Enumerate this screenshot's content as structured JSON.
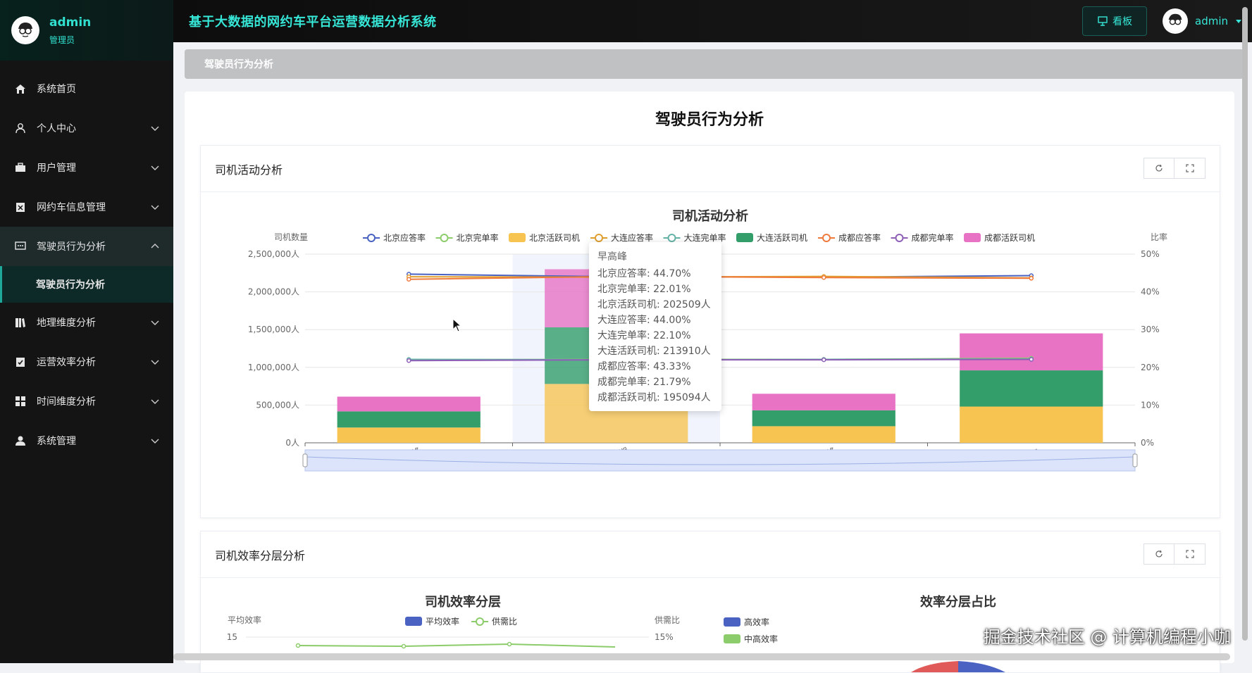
{
  "user": {
    "name": "admin",
    "role": "管理员"
  },
  "menu": [
    {
      "label": "系统首页",
      "icon": "home-icon",
      "chevron": false
    },
    {
      "label": "个人中心",
      "icon": "user-icon",
      "chevron": true
    },
    {
      "label": "用户管理",
      "icon": "briefcase-icon",
      "chevron": true
    },
    {
      "label": "网约车信息管理",
      "icon": "clipboard-icon",
      "chevron": true
    },
    {
      "label": "驾驶员行为分析",
      "icon": "chat-icon",
      "chevron": true,
      "active": true
    },
    {
      "label": "地理维度分析",
      "icon": "books-icon",
      "chevron": true
    },
    {
      "label": "运营效率分析",
      "icon": "clipboard-check-icon",
      "chevron": true
    },
    {
      "label": "时间维度分析",
      "icon": "grid-icon",
      "chevron": true
    },
    {
      "label": "系统管理",
      "icon": "person-icon",
      "chevron": true
    }
  ],
  "submenu_active": "驾驶员行为分析",
  "header": {
    "title": "基于大数据的网约车平台运营数据分析系统",
    "board_label": "看板",
    "user": "admin"
  },
  "breadcrumb": "驾驶员行为分析",
  "page_title": "驾驶员行为分析",
  "card1": {
    "title": "司机活动分析"
  },
  "card2": {
    "title": "司机效率分层分析"
  },
  "tooltip": {
    "title": "早高峰",
    "rows": [
      "北京应答率: 44.70%",
      "北京完单率: 22.01%",
      "北京活跃司机: 202509人",
      "大连应答率: 44.00%",
      "大连完单率: 22.10%",
      "大连活跃司机: 213910人",
      "成都应答率: 43.33%",
      "成都完单率: 21.79%",
      "成都活跃司机: 195094人"
    ]
  },
  "watermark": "掘金技术社区 @ 计算机编程小咖",
  "chart_data": [
    {
      "type": "bar",
      "title": "司机活动分析",
      "ylabel": "司机数量",
      "y2label": "比率",
      "categories": [
        "早高峰",
        "平峰期",
        "晚高峰",
        "夜间"
      ],
      "yticks": [
        "0人",
        "500,000人",
        "1,000,000人",
        "1,500,000人",
        "2,000,000人",
        "2,500,000人"
      ],
      "y2ticks": [
        "0%",
        "10%",
        "20%",
        "30%",
        "40%",
        "50%"
      ],
      "ylim": [
        0,
        2500000
      ],
      "y2lim": [
        0,
        50
      ],
      "legend": [
        "北京应答率",
        "北京完单率",
        "北京活跃司机",
        "大连应答率",
        "大连完单率",
        "大连活跃司机",
        "成都应答率",
        "成都完单率",
        "成都活跃司机"
      ],
      "bar_series": [
        {
          "name": "北京活跃司机",
          "color": "#f7c452",
          "values": [
            202509,
            780000,
            220000,
            480000
          ]
        },
        {
          "name": "大连活跃司机",
          "color": "#339e6a",
          "values": [
            213910,
            750000,
            210000,
            480000
          ]
        },
        {
          "name": "成都活跃司机",
          "color": "#e872c4",
          "values": [
            195094,
            770000,
            220000,
            490000
          ]
        }
      ],
      "line_series": [
        {
          "name": "北京应答率",
          "color": "#4a62c2",
          "values": [
            44.7,
            44.0,
            43.9,
            44.3
          ]
        },
        {
          "name": "北京完单率",
          "color": "#8ccc6a",
          "values": [
            22.01,
            22.1,
            22.1,
            22.4
          ]
        },
        {
          "name": "大连应答率",
          "color": "#e0a030",
          "values": [
            44.0,
            43.9,
            44.1,
            43.7
          ]
        },
        {
          "name": "大连完单率",
          "color": "#66b3a8",
          "values": [
            22.1,
            22.0,
            22.1,
            22.2
          ]
        },
        {
          "name": "成都应答率",
          "color": "#ef7a3c",
          "values": [
            43.33,
            44.1,
            43.8,
            43.6
          ]
        },
        {
          "name": "成都完单率",
          "color": "#8e5fb6",
          "values": [
            21.79,
            22.0,
            22.0,
            22.1
          ]
        }
      ],
      "highlight_category": "平峰期"
    },
    {
      "type": "line",
      "title": "司机效率分层",
      "ylabel": "平均效率",
      "y2label": "供需比",
      "legend": [
        "平均效率",
        "供需比"
      ],
      "yticks": [
        "15"
      ],
      "y2ticks": [
        "15%"
      ]
    },
    {
      "type": "pie",
      "title": "效率分层占比",
      "legend": [
        "高效率",
        "中高效率"
      ],
      "colors": [
        "#4a62c2",
        "#8ccc6a",
        "#e05a5a"
      ]
    }
  ]
}
